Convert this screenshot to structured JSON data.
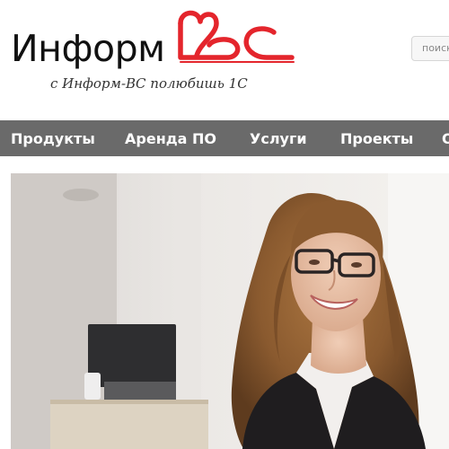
{
  "site": {
    "logo_text": "Информ",
    "logo_mark_name": "ВС",
    "tagline": "с Информ-ВС полюбишь 1С"
  },
  "search": {
    "placeholder": "поиск"
  },
  "nav": {
    "items": [
      {
        "label": "Продукты"
      },
      {
        "label": "Аренда ПО"
      },
      {
        "label": "Услуги"
      },
      {
        "label": "Проекты"
      }
    ]
  },
  "colors": {
    "brand_red": "#e4252c",
    "nav_bg": "#6a6a6a",
    "nav_text": "#ffffff",
    "logo_text": "#111111"
  },
  "hero": {
    "image_subject": "smiling woman with glasses in office"
  }
}
